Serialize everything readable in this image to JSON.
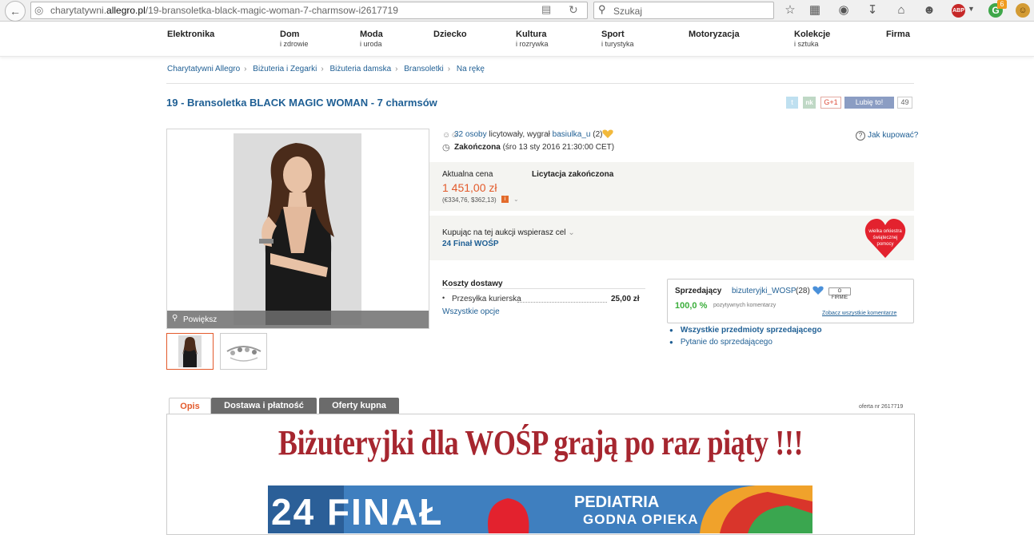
{
  "browser": {
    "url_prefix": "charytatywni.",
    "url_domain": "allegro.pl",
    "url_path": "/19-bransoletka-black-magic-woman-7-charmsow-i2617719",
    "search_placeholder": "Szukaj",
    "abp_label": "ABP",
    "g_label": "G",
    "g_badge": "6"
  },
  "nav": {
    "items": [
      {
        "line1": "Elektronika",
        "line2": ""
      },
      {
        "line1": "Dom",
        "line2": "i zdrowie"
      },
      {
        "line1": "Moda",
        "line2": "i uroda"
      },
      {
        "line1": "Dziecko",
        "line2": ""
      },
      {
        "line1": "Kultura",
        "line2": "i rozrywka"
      },
      {
        "line1": "Sport",
        "line2": "i turystyka"
      },
      {
        "line1": "Motoryzacja",
        "line2": ""
      },
      {
        "line1": "Kolekcje",
        "line2": "i sztuka"
      },
      {
        "line1": "Firma",
        "line2": ""
      }
    ]
  },
  "breadcrumb": [
    "Charytatywni Allegro",
    "Biżuteria i Zegarki",
    "Biżuteria damska",
    "Bransoletki",
    "Na rękę"
  ],
  "breadcrumb_sep": "›",
  "title": "19 - Bransoletka BLACK MAGIC WOMAN - 7 charmsów",
  "social": {
    "twitter": "t",
    "nk": "nk",
    "gplus": "G+1",
    "fb_like": "Lubię to!",
    "fb_count": "49"
  },
  "image": {
    "zoom_label": "Powiększ"
  },
  "auction": {
    "bidders_link": "32 osoby",
    "bidders_text": " licytowały, wygrał ",
    "winner": "basiulka_u",
    "winner_count": " (2)",
    "how_to_buy": "Jak kupować?",
    "ended_label": "Zakończona",
    "ended_date": " (śro 13 sty 2016 21:30:00 CET)"
  },
  "price": {
    "label": "Aktualna cena",
    "status": "Licytacja zakończona",
    "value": "1 451,00 zł",
    "converted": "(€334,76, $362,13)"
  },
  "charity": {
    "label": "Kupując na tej aukcji wspierasz cel",
    "name": "24 Finał WOŚP",
    "logo_text": "wielka orkiestra świątecznej pomocy"
  },
  "shipping": {
    "title": "Koszty dostawy",
    "method": "Przesyłka kurierska",
    "price": "25,00 zł",
    "all_options": "Wszystkie opcje"
  },
  "seller": {
    "label": "Sprzedający",
    "name": "bizuteryjki_WOSP",
    "count": "(28)",
    "badge": "O FIRMIE",
    "rating": "100,0 %",
    "rating_text": "pozytywnych komentarzy",
    "comments_link": "Zobacz wszystkie komentarze",
    "all_items": "Wszystkie przedmioty sprzedającego",
    "ask": "Pytanie do sprzedającego"
  },
  "tabs": [
    "Opis",
    "Dostawa i płatność",
    "Oferty kupna"
  ],
  "offer_number": "oferta nr 2617719",
  "description": {
    "heading": "Biżuteryjki dla WOŚP grają po raz piąty !!!",
    "banner_final": "24 FINAŁ",
    "banner_line1": "PEDIATRIA",
    "banner_line2": "GODNA OPIEKA"
  },
  "colors": {
    "accent": "#e35a2b",
    "link": "#1f5f94",
    "heading_red": "#a6262f",
    "rating_green": "#3bae3b"
  }
}
